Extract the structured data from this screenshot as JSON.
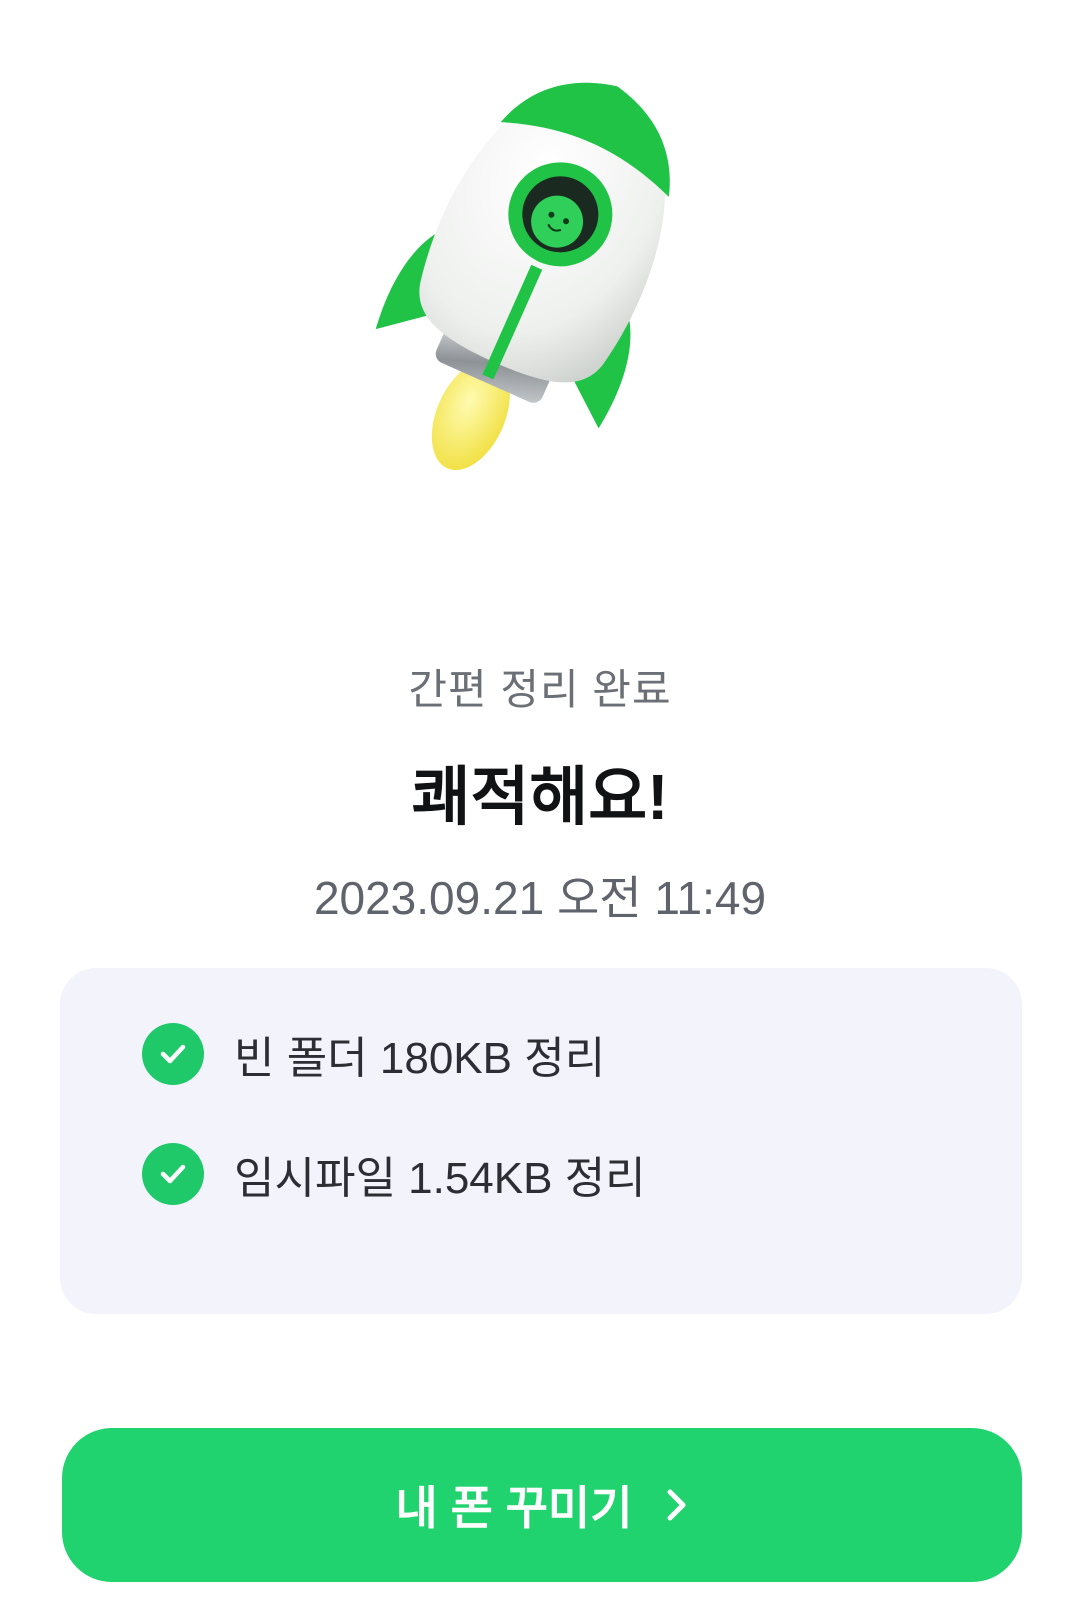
{
  "hero": {
    "illustration": "rocket-illustration"
  },
  "result": {
    "subtitle": "간편 정리 완료",
    "title": "쾌적해요!",
    "timestamp": "2023.09.21 오전 11:49"
  },
  "cleaned_items": [
    {
      "icon": "check-circle-icon",
      "text": "빈 폴더 180KB 정리"
    },
    {
      "icon": "check-circle-icon",
      "text": "임시파일 1.54KB 정리"
    }
  ],
  "cta": {
    "label": "내 폰 꾸미기",
    "icon": "chevron-right-icon"
  },
  "colors": {
    "accent": "#21d36e",
    "check": "#1fc96a",
    "card_bg": "#f3f3fb",
    "title": "#111214",
    "subtitle": "#6b6f76"
  }
}
